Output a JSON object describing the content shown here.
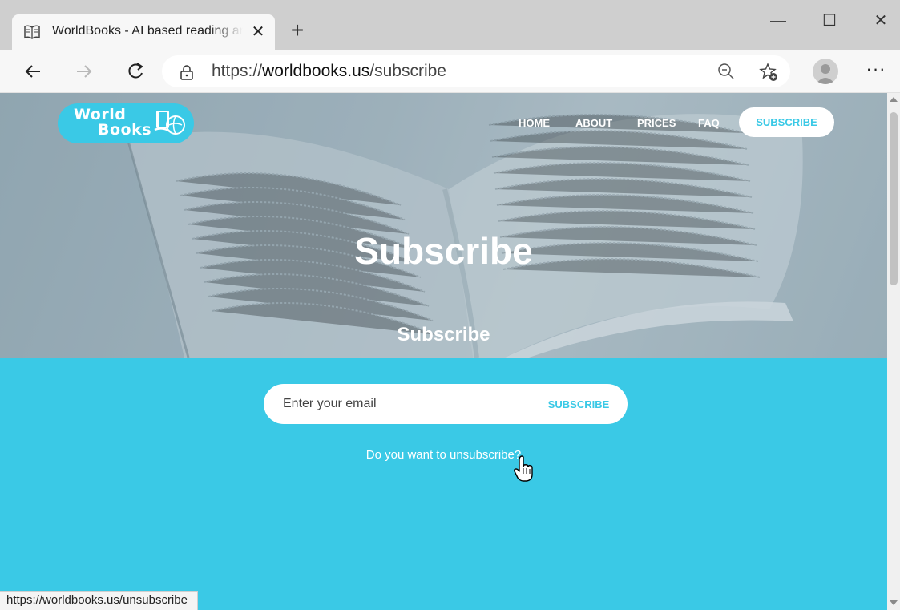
{
  "browser": {
    "tab": {
      "title": "WorldBooks - AI based reading and learning",
      "favicon": "book-icon",
      "close_label": "✕"
    },
    "new_tab_label": "+",
    "window_controls": {
      "minimize": "—",
      "maximize": "☐",
      "close": "✕"
    },
    "address": {
      "scheme": "https://",
      "host": "worldbooks.us",
      "path": "/subscribe"
    },
    "status_url": "https://worldbooks.us/unsubscribe",
    "menu_label": "···",
    "icons": [
      "back-icon",
      "forward-icon",
      "refresh-icon",
      "lock-icon",
      "zoom-out-icon",
      "add-favorite-icon",
      "profile-avatar",
      "more-menu-icon"
    ]
  },
  "site": {
    "logo": {
      "line1": "World",
      "line2": "Books"
    },
    "nav": {
      "home": "HOME",
      "about": "ABOUT",
      "prices": "PRICES",
      "faq": "FAQ",
      "subscribe": "SUBSCRIBE"
    },
    "hero_title": "Subscribe",
    "section": {
      "heading": "Subscribe",
      "email_placeholder": "Enter your email",
      "submit_label": "SUBSCRIBE",
      "unsubscribe_link": "Do you want to unsubscribe?"
    }
  },
  "colors": {
    "brand": "#3ac9e6",
    "white": "#ffffff"
  }
}
